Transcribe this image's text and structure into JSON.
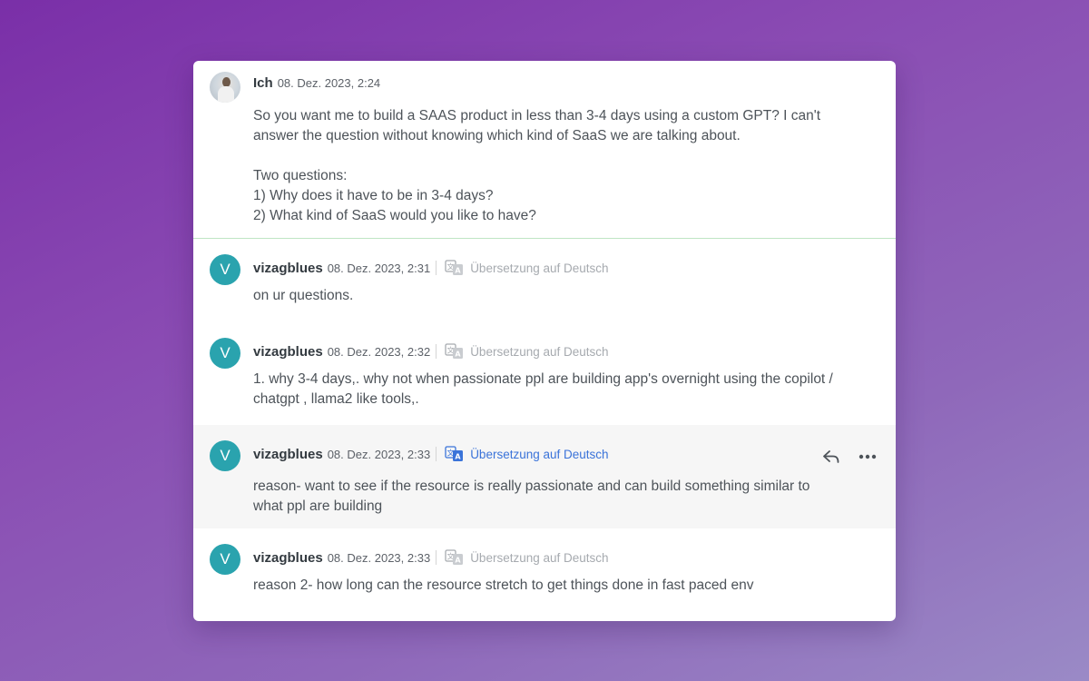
{
  "messages": [
    {
      "author": "Ich",
      "timestamp": "08. Dez. 2023, 2:24",
      "lines": [
        "So you want me to build a SAAS product in less than 3-4 days using a custom GPT? I can't",
        "answer the question without knowing which kind of SaaS we are talking about.",
        "",
        "Two questions:",
        "1) Why does it have to be in 3-4 days?",
        "2) What kind of SaaS would you like to have?"
      ]
    },
    {
      "avatar_letter": "V",
      "author": "vizagblues",
      "timestamp": "08. Dez. 2023, 2:31",
      "translate_label": "Übersetzung auf Deutsch",
      "lines": [
        "on ur questions."
      ]
    },
    {
      "avatar_letter": "V",
      "author": "vizagblues",
      "timestamp": "08. Dez. 2023, 2:32",
      "translate_label": "Übersetzung auf Deutsch",
      "lines": [
        "1. why 3-4 days,. why not when passionate ppl are building app's overnight using the copilot /",
        "chatgpt , llama2 like tools,."
      ]
    },
    {
      "avatar_letter": "V",
      "author": "vizagblues",
      "timestamp": "08. Dez. 2023, 2:33",
      "translate_label": "Übersetzung auf Deutsch",
      "lines": [
        "reason- want to see if the resource is really passionate and can build something similar to",
        "what ppl are building"
      ]
    },
    {
      "avatar_letter": "V",
      "author": "vizagblues",
      "timestamp": "08. Dez. 2023, 2:33",
      "translate_label": "Übersetzung auf Deutsch",
      "lines": [
        "reason 2- how long can the resource stretch to get things done in fast paced env"
      ]
    }
  ],
  "hovered_message_actions": [
    "reply-icon",
    "more-options-icon"
  ],
  "colors": {
    "avatar_bg": "#2aa3ae",
    "translate_active": "#3a73d9",
    "translate_inactive": "#a6aaaf",
    "divider": "#bfe5c4",
    "hover_row_bg": "#f6f6f6"
  }
}
